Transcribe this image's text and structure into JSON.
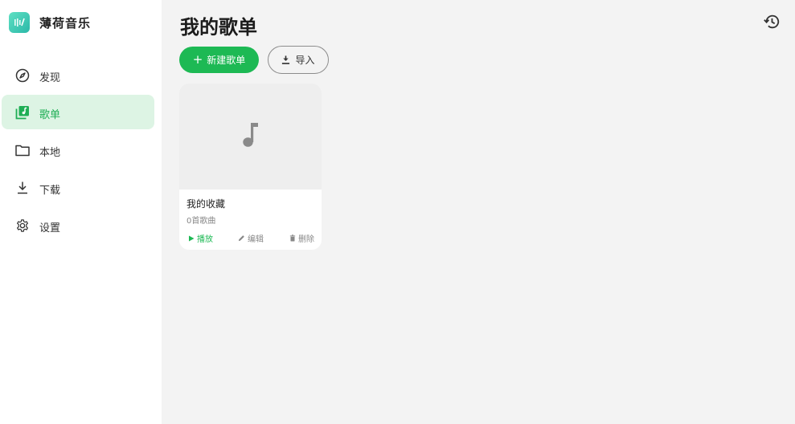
{
  "app": {
    "name": "薄荷音乐",
    "logo_icon": "mint-logo-icon",
    "accent_color": "#1db954"
  },
  "sidebar": {
    "items": [
      {
        "label": "发现",
        "icon": "compass-icon",
        "active": false
      },
      {
        "label": "歌单",
        "icon": "playlist-icon",
        "active": true
      },
      {
        "label": "本地",
        "icon": "folder-icon",
        "active": false
      },
      {
        "label": "下载",
        "icon": "download-icon",
        "active": false
      },
      {
        "label": "设置",
        "icon": "gear-icon",
        "active": false
      }
    ]
  },
  "main": {
    "title": "我的歌单",
    "history_icon": "history-icon",
    "new_playlist_label": "新建歌单",
    "import_label": "导入",
    "playlists": [
      {
        "title": "我的收藏",
        "count": "0首歌曲",
        "cover_icon": "music-note-icon",
        "play_label": "播放",
        "edit_label": "编辑",
        "delete_label": "删除"
      }
    ]
  }
}
